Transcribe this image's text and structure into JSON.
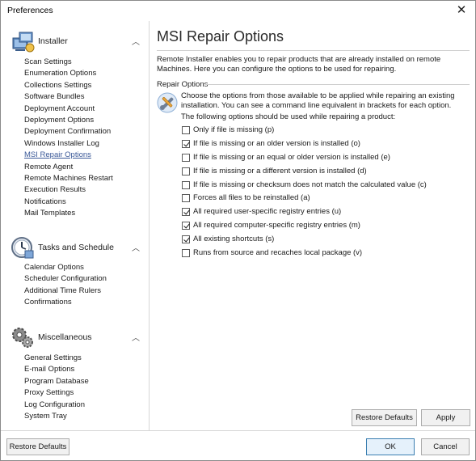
{
  "window": {
    "title": "Preferences",
    "close_glyph": "✕"
  },
  "sidebar": {
    "sections": [
      {
        "title": "Installer",
        "icon": "installer-icon",
        "items": [
          "Scan Settings",
          "Enumeration Options",
          "Collections Settings",
          "Software Bundles",
          "Deployment Account",
          "Deployment Options",
          "Deployment Confirmation",
          "Windows Installer Log",
          "MSI Repair Options",
          "Remote Agent",
          "Remote Machines Restart",
          "Execution Results",
          "Notifications",
          "Mail Templates"
        ],
        "active": "MSI Repair Options"
      },
      {
        "title": "Tasks and Schedule",
        "icon": "clock-icon",
        "items": [
          "Calendar Options",
          "Scheduler Configuration",
          "Additional Time Rulers",
          "Confirmations"
        ]
      },
      {
        "title": "Miscellaneous",
        "icon": "gears-icon",
        "items": [
          "General Settings",
          "E-mail Options",
          "Program Database",
          "Proxy Settings",
          "Log Configuration",
          "System Tray"
        ]
      }
    ],
    "chevron_glyph": "︿"
  },
  "main": {
    "title": "MSI Repair Options",
    "intro": "Remote Installer enables you to repair products that are already installed on remote Machines. Here you can configure the options to be used for repairing.",
    "group_label": "Repair Options",
    "group_desc": "Choose the options from those available to be applied while repairing an existing installation. You can see a command line equivalent in brackets for each option.",
    "sub_label": "The following options should be used while repairing a product:",
    "options": [
      {
        "label": "Only if file is missing (p)",
        "checked": false
      },
      {
        "label": "If file is missing or an older version is installed (o)",
        "checked": true
      },
      {
        "label": "If file is missing or an equal or older version is installed (e)",
        "checked": false
      },
      {
        "label": "If file is missing or a different version is installed (d)",
        "checked": false
      },
      {
        "label": "If file is missing or checksum does not match the calculated value (c)",
        "checked": false
      },
      {
        "label": "Forces all files to be reinstalled (a)",
        "checked": false
      },
      {
        "label": "All required user-specific registry entries (u)",
        "checked": true
      },
      {
        "label": "All required computer-specific registry entries (m)",
        "checked": true
      },
      {
        "label": "All existing shortcuts (s)",
        "checked": true
      },
      {
        "label": "Runs from source and recaches local package (v)",
        "checked": false
      }
    ],
    "restore_defaults_label": "Restore Defaults",
    "apply_label": "Apply"
  },
  "footer": {
    "restore_defaults_label": "Restore Defaults",
    "ok_label": "OK",
    "cancel_label": "Cancel"
  }
}
